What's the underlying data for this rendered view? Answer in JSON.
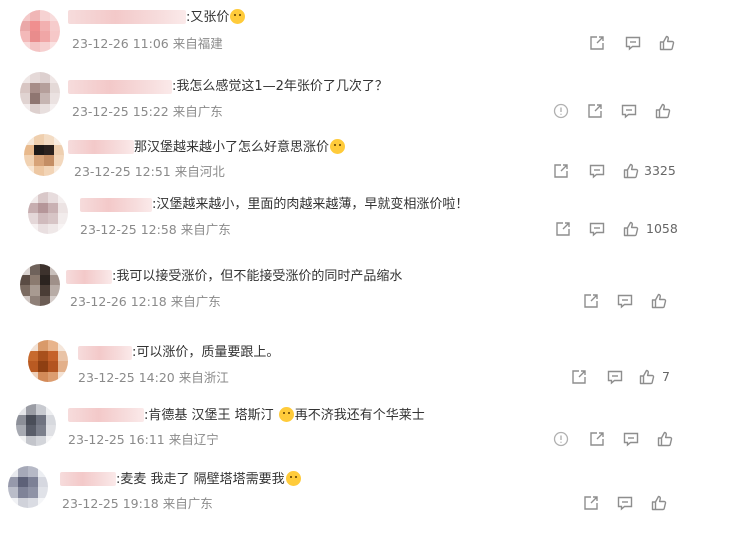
{
  "comments": [
    {
      "text": ":又张价",
      "time": "23-12-26 11:06",
      "loc": "来自福建",
      "likes": ""
    },
    {
      "text": ":我怎么感觉这1—2年张价了几次了？",
      "time": "23-12-25 15:22",
      "loc": "来自广东",
      "likes": ""
    },
    {
      "text": "那汉堡越来越小了怎么好意思涨价",
      "time": "23-12-25 12:51",
      "loc": "来自河北",
      "likes": "3325"
    },
    {
      "text": ":汉堡越来越小，里面的肉越来越薄，早就变相涨价啦！",
      "time": "23-12-25 12:58",
      "loc": "来自广东",
      "likes": "1058"
    },
    {
      "text": ":我可以接受涨价，但不能接受涨价的同时产品缩水",
      "time": "23-12-26 12:18",
      "loc": "来自广东",
      "likes": ""
    },
    {
      "text": ":可以涨价，质量要跟上。",
      "time": "23-12-25 14:20",
      "loc": "来自浙江",
      "likes": "7"
    },
    {
      "text_a": ":肯德基 汉堡王 塔斯汀",
      "text_b": "再不济我还有个华莱士",
      "time": "23-12-25 16:11",
      "loc": "来自辽宁",
      "likes": ""
    },
    {
      "text_a": ":麦麦 我走了 隔壁塔塔需要我",
      "time": "23-12-25 19:18",
      "loc": "来自广东",
      "likes": ""
    }
  ],
  "icons": {
    "report": "report-icon",
    "share": "share-icon",
    "comment": "comment-icon",
    "like": "like-icon"
  },
  "colors": {
    "text": "#333333",
    "meta": "#8a8a8a",
    "icon": "#8e8e8e",
    "name_blur": "#f3c9c9"
  }
}
